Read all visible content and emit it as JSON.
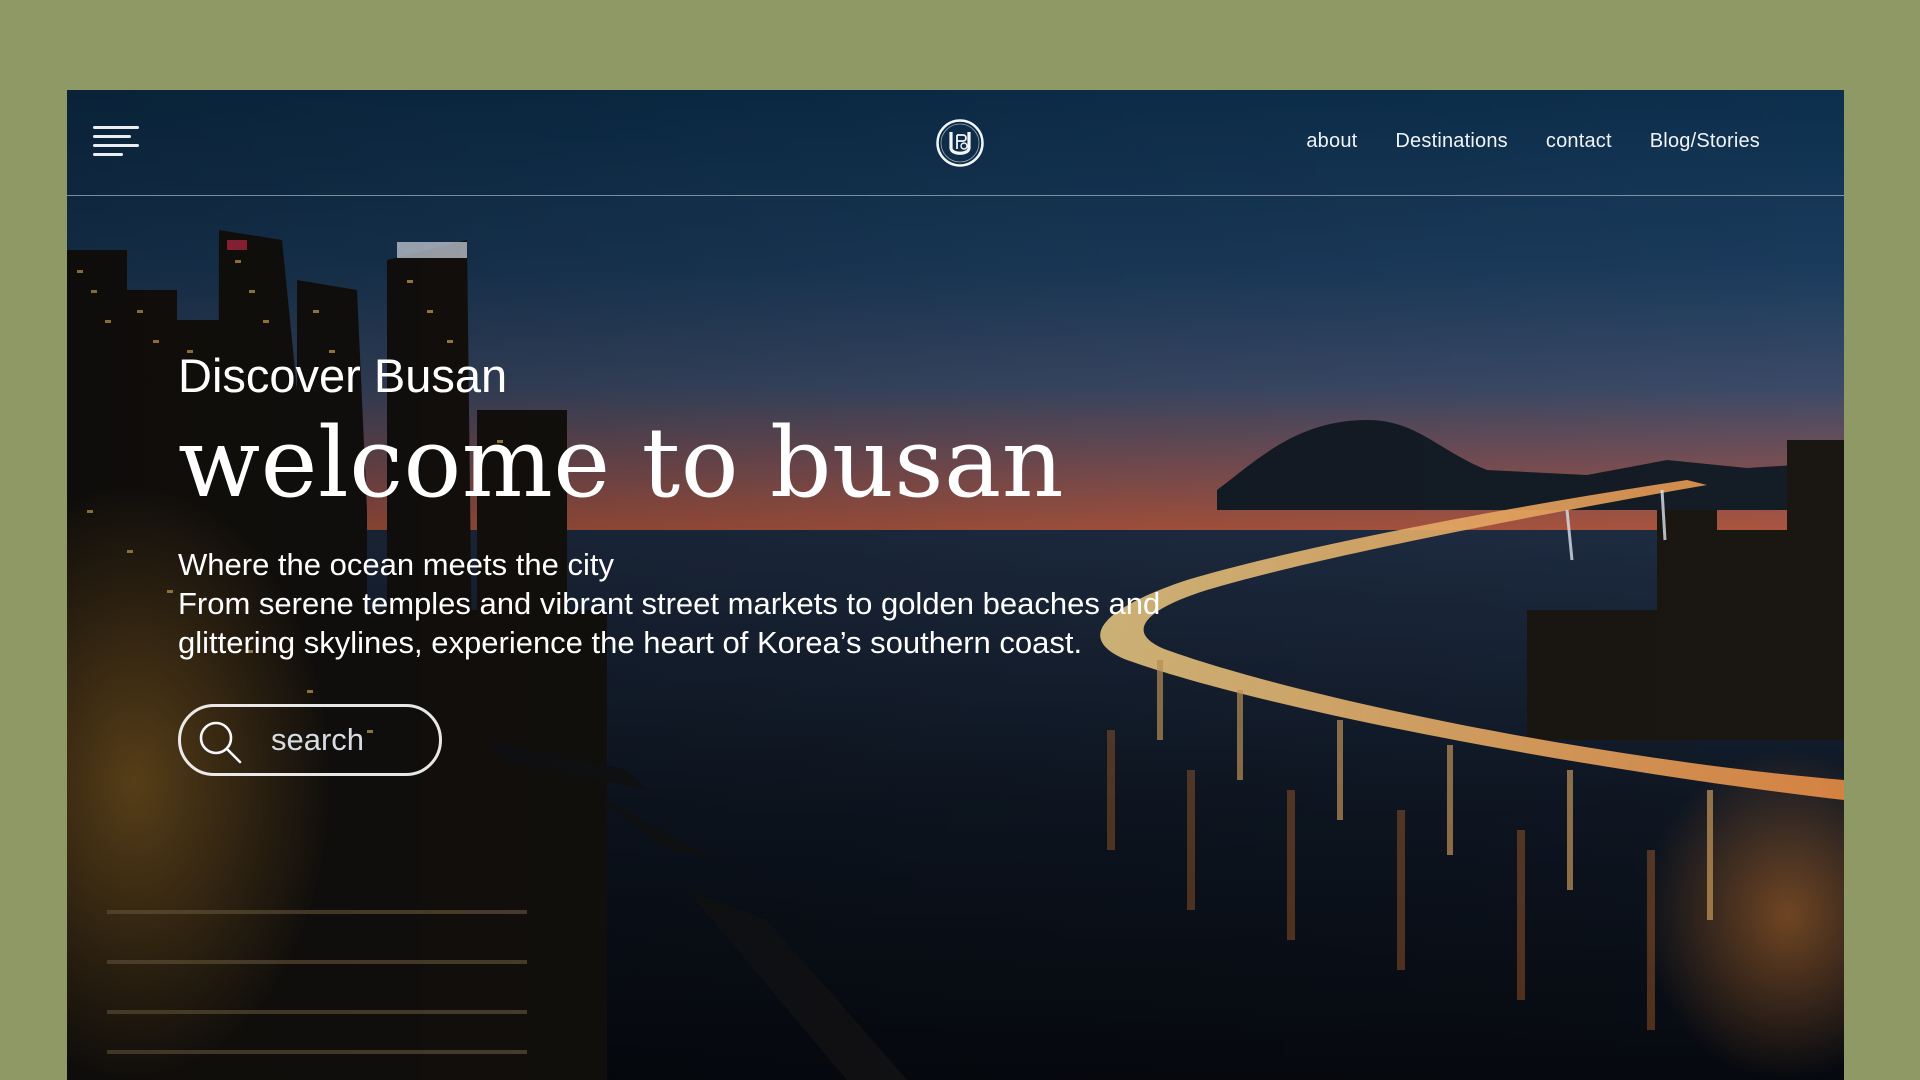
{
  "header": {
    "nav": [
      {
        "label": "about"
      },
      {
        "label": "Destinations"
      },
      {
        "label": "contact"
      },
      {
        "label": "Blog/Stories"
      }
    ]
  },
  "hero": {
    "eyebrow": "Discover Busan",
    "title": "welcome to busan",
    "tagline": "Where the ocean meets the city",
    "description": "From serene temples and vibrant street markets to golden beaches and glittering skylines, experience the heart of Korea’s southern coast."
  },
  "search": {
    "placeholder": "search",
    "value": ""
  },
  "colors": {
    "page_background": "#8e9966",
    "text": "#ffffff"
  },
  "icons": [
    "menu-icon",
    "logo-monogram",
    "search-icon"
  ]
}
